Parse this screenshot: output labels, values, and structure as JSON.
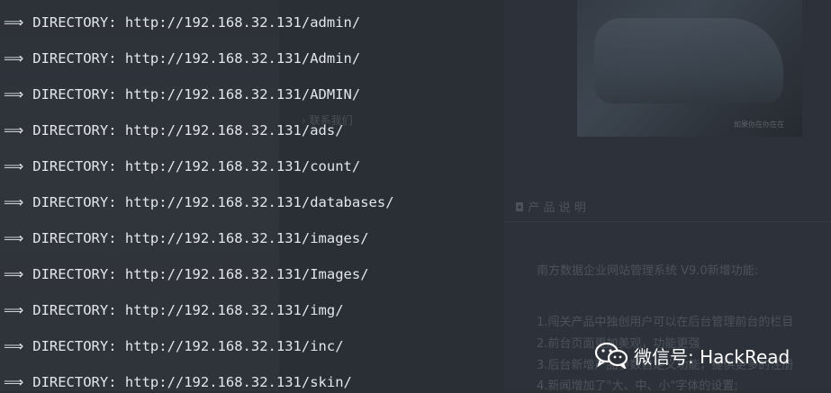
{
  "terminal": {
    "arrow_glyph": "⟹",
    "lines": [
      {
        "label": "DIRECTORY:",
        "url": "http://192.168.32.131/admin/"
      },
      {
        "label": "DIRECTORY:",
        "url": "http://192.168.32.131/Admin/"
      },
      {
        "label": "DIRECTORY:",
        "url": "http://192.168.32.131/ADMIN/"
      },
      {
        "label": "DIRECTORY:",
        "url": "http://192.168.32.131/ads/"
      },
      {
        "label": "DIRECTORY:",
        "url": "http://192.168.32.131/count/"
      },
      {
        "label": "DIRECTORY:",
        "url": "http://192.168.32.131/databases/"
      },
      {
        "label": "DIRECTORY:",
        "url": "http://192.168.32.131/images/"
      },
      {
        "label": "DIRECTORY:",
        "url": "http://192.168.32.131/Images/"
      },
      {
        "label": "DIRECTORY:",
        "url": "http://192.168.32.131/img/"
      },
      {
        "label": "DIRECTORY:",
        "url": "http://192.168.32.131/inc/"
      },
      {
        "label": "DIRECTORY:",
        "url": "http://192.168.32.131/skin/"
      }
    ]
  },
  "background_page": {
    "sidebar_link": "› 联系我们",
    "car_caption": "如果你在你在在",
    "section_title": "◘ 产 品 说 明",
    "intro": "南方数据企业网站管理系统 V9.0新增功能:",
    "items": [
      "1.闯关产品中独创用户可以在后台管理前台的栏目",
      "2.前台页面更加美观，功能更强",
      "3.后台新增产品参数自定义功能，提供更多的注册",
      "4.新闻增加了\"大、中、小\"字体的设置;"
    ]
  },
  "watermark": {
    "icon": "wechat-icon",
    "text": "微信号: HackRead"
  },
  "colors": {
    "terminal_text": "#e4e6ea",
    "background": "#2b2f36",
    "faded_page_text": "#4d535b",
    "watermark_text": "#ffffff"
  }
}
